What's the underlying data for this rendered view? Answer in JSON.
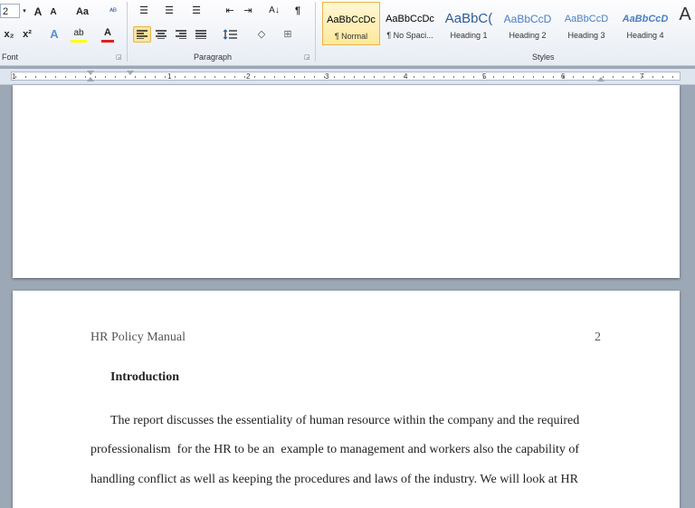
{
  "ribbon": {
    "font": {
      "size_value": "2",
      "group_label": "Font"
    },
    "paragraph": {
      "group_label": "Paragraph"
    },
    "styles": {
      "group_label": "Styles",
      "items": [
        {
          "preview": "AaBbCcDc",
          "name": "¶ Normal"
        },
        {
          "preview": "AaBbCcDc",
          "name": "¶ No Spaci..."
        },
        {
          "preview": "AaBbC(",
          "name": "Heading 1"
        },
        {
          "preview": "AaBbCcD",
          "name": "Heading 2"
        },
        {
          "preview": "AaBbCcD",
          "name": "Heading 3"
        },
        {
          "preview": "AaBbCcD",
          "name": "Heading 4"
        },
        {
          "preview": "A",
          "name": ""
        }
      ]
    },
    "buttons": {
      "grow_font": "A",
      "shrink_font": "A",
      "change_case": "Aa",
      "spelling": "ᴬᴮ",
      "bullets": "☰",
      "numbering": "☰",
      "multilevel": "☰",
      "decrease_indent": "⇤",
      "increase_indent": "⇥",
      "sort": "A↓",
      "show_marks": "¶",
      "subscript": "x₂",
      "superscript": "x²",
      "text_effects": "A",
      "highlight": "ab",
      "font_color": "A",
      "shading": "◇",
      "borders": "⊞"
    }
  },
  "ruler": {
    "numbers": [
      "1",
      "1",
      "2",
      "3",
      "4",
      "5",
      "6",
      "7"
    ]
  },
  "document": {
    "header_left": "HR Policy Manual",
    "header_right": "2",
    "heading": "Introduction",
    "lines": [
      "The report discusses the essentiality of human resource within the company and the required",
      "professionalism  for the HR to be an  example to management and workers also the capability of",
      "handling conflict as well as keeping the procedures and laws of the industry. We will look at HR"
    ]
  }
}
